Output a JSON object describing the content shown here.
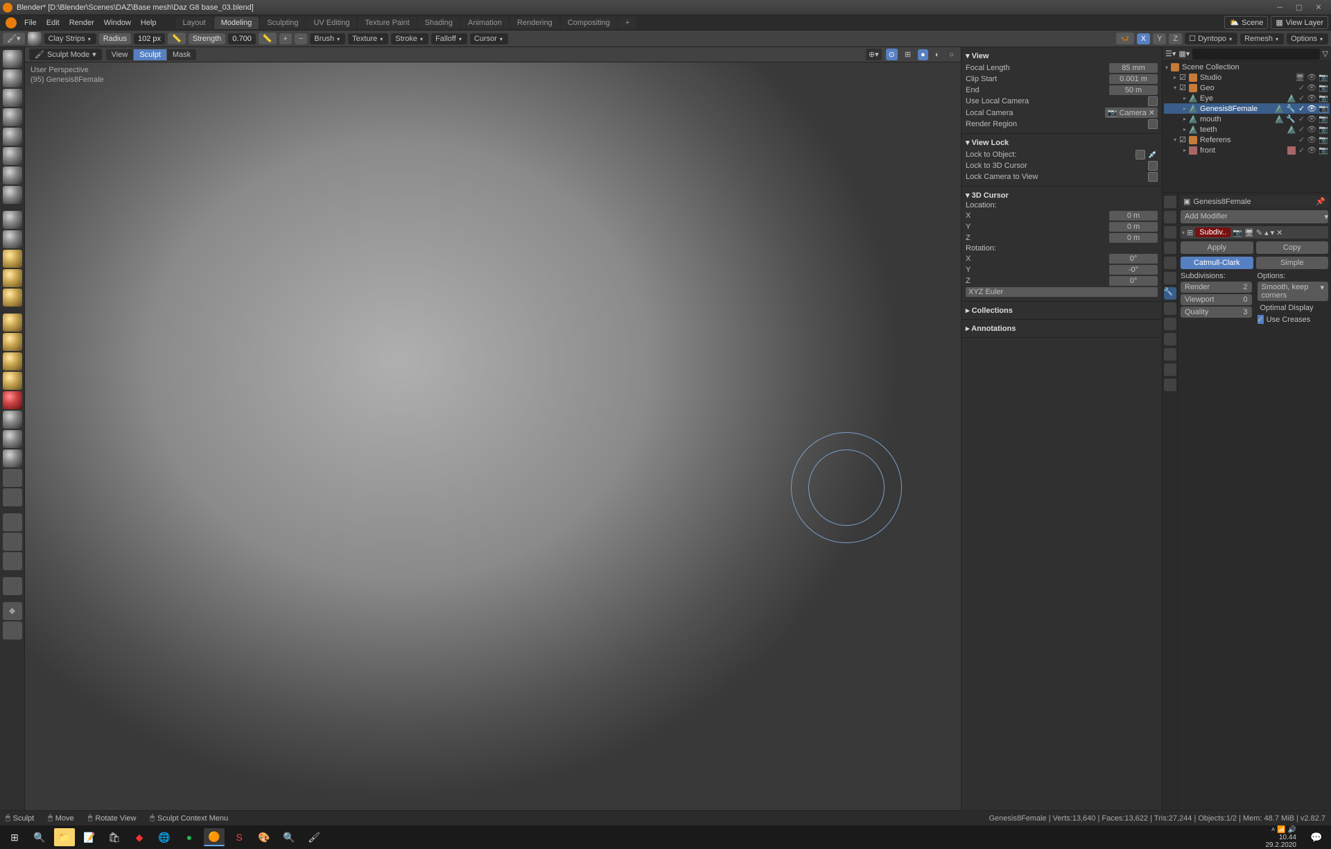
{
  "title": "Blender* [D:\\Blender\\Scenes\\DAZ\\Base mesh\\Daz G8 base_03.blend]",
  "menu": {
    "file": "File",
    "edit": "Edit",
    "render": "Render",
    "window": "Window",
    "help": "Help"
  },
  "workspaces": [
    "Layout",
    "Modeling",
    "Sculpting",
    "UV Editing",
    "Texture Paint",
    "Shading",
    "Animation",
    "Rendering",
    "Compositing"
  ],
  "workspace_active": 1,
  "scene": "Scene",
  "viewlayer": "View Layer",
  "tool_header": {
    "brush": "Clay Strips",
    "radius_lab": "Radius",
    "radius_val": "102 px",
    "strength_lab": "Strength",
    "strength_val": "0.700",
    "brush_dd": "Brush",
    "texture_dd": "Texture",
    "stroke_dd": "Stroke",
    "falloff_dd": "Falloff",
    "cursor_dd": "Cursor",
    "sym": [
      "X",
      "Y",
      "Z"
    ],
    "dyntopo": "Dyntopo",
    "remesh": "Remesh",
    "options": "Options"
  },
  "vp": {
    "mode": "Sculpt Mode",
    "seg": [
      "View",
      "Sculpt",
      "Mask"
    ],
    "persp": "User Perspective",
    "obj": "(95) Genesis8Female"
  },
  "npanel": {
    "view": "View",
    "focal_lab": "Focal Length",
    "focal_val": "85 mm",
    "clip_lab": "Clip Start",
    "clip_val": "0.001 m",
    "end_lab": "End",
    "end_val": "50 m",
    "localcam": "Use Local Camera",
    "localcam_lab": "Local Camera",
    "localcam_val": "Camera",
    "renderregion": "Render Region",
    "viewlock": "View Lock",
    "locktoobj": "Lock to Object:",
    "lockto3d": "Lock to 3D Cursor",
    "lockcam": "Lock Camera to View",
    "cursor": "3D Cursor",
    "loc": "Location:",
    "x": "X",
    "y": "Y",
    "z": "Z",
    "zero": "0 m",
    "rot": "Rotation:",
    "rx": "0°",
    "ry": "-0°",
    "rz": "0°",
    "euler": "XYZ Euler",
    "collections": "Collections",
    "annotations": "Annotations"
  },
  "outliner": {
    "root": "Scene Collection",
    "studio": "Studio",
    "geo": "Geo",
    "eye": "Eye",
    "g8": "Genesis8Female",
    "mouth": "mouth",
    "teeth": "teeth",
    "referens": "Referens",
    "front": "front"
  },
  "props": {
    "obj": "Genesis8Female",
    "addmod": "Add Modifier",
    "modname": "Subdiv..",
    "apply": "Apply",
    "copy": "Copy",
    "catmull": "Catmull-Clark",
    "simple": "Simple",
    "subdiv_lab": "Subdivisions:",
    "opts_lab": "Options:",
    "render_lab": "Render",
    "render_val": "2",
    "vp_lab": "Viewport",
    "vp_val": "0",
    "qual_lab": "Quality",
    "qual_val": "3",
    "uvsmooth_lab": "Smooth, keep corners",
    "optdisp": "Optimal Display",
    "creases": "Use Creases"
  },
  "status": {
    "sculpt": "Sculpt",
    "move": "Move",
    "rotate": "Rotate View",
    "menu": "Sculpt Context Menu",
    "stats": "Genesis8Female | Verts:13,640 | Faces:13,622 | Tris:27,244 | Objects:1/2 | Mem: 48.7 MiB | v2.82.7"
  },
  "clock": {
    "time": "10.44",
    "date": "29.2.2020"
  }
}
